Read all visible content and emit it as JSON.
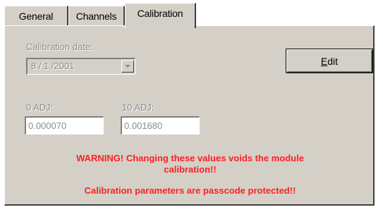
{
  "tabs": [
    {
      "label": "General",
      "active": false
    },
    {
      "label": "Channels",
      "active": false
    },
    {
      "label": "Calibration",
      "active": true
    }
  ],
  "calibration": {
    "date_label": "Calibration date:",
    "date_value": "8 / 1 /2001",
    "edit_button": {
      "accel": "E",
      "rest": "dit"
    },
    "adj0_label": "0 ADJ:",
    "adj0_value": "0.000070",
    "adj10_label": "10 ADJ:",
    "adj10_value": "0.001680",
    "warning_line1": "WARNING! Changing these values voids the module",
    "warning_line2": "calibration!!",
    "protected_note": "Calibration parameters are passcode protected!!"
  },
  "colors": {
    "warning": "#ff2020",
    "disabled_text": "#8c8c8c",
    "dialog_face": "#d4d0c8"
  }
}
